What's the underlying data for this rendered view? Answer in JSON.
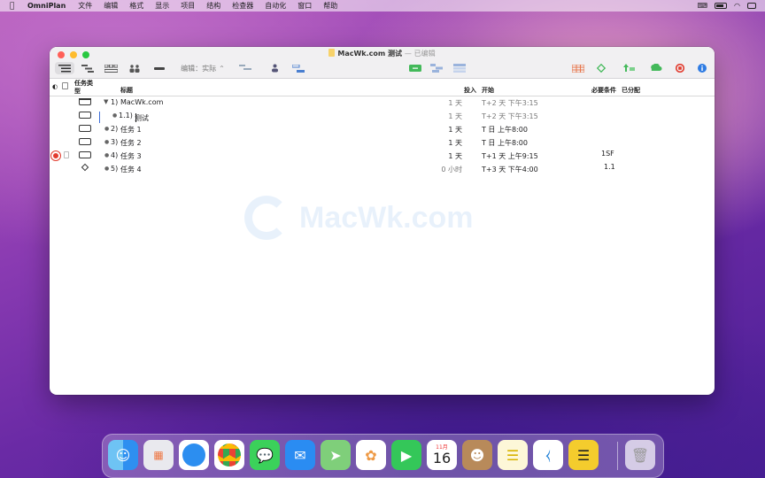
{
  "menubar": {
    "app_name": "OmniPlan",
    "items": [
      "文件",
      "编辑",
      "格式",
      "显示",
      "项目",
      "结构",
      "检查器",
      "自动化",
      "窗口",
      "帮助"
    ]
  },
  "window": {
    "title": "MacWk.com 测试",
    "separator": "—",
    "status": "已编辑"
  },
  "toolbar": {
    "edit_mode_label": "编辑：实际"
  },
  "table": {
    "headers": {
      "task_type": "任务类型",
      "title": "标题",
      "effort": "投入",
      "start": "开始",
      "prereq": "必要条件",
      "assigned": "已分配"
    },
    "rows": [
      {
        "number": "1)",
        "title": "MacWk.com",
        "effort": "1 天",
        "start": "T+2 天 下午3:15",
        "prereq": "",
        "type": "group"
      },
      {
        "number": "1.1)",
        "title": "测试",
        "effort": "1 天",
        "start": "T+2 天 下午3:15",
        "prereq": "",
        "type": "task"
      },
      {
        "number": "2)",
        "title": "任务 1",
        "effort": "1 天",
        "start": "T 日 上午8:00",
        "prereq": "",
        "type": "task"
      },
      {
        "number": "3)",
        "title": "任务 2",
        "effort": "1 天",
        "start": "T 日 上午8:00",
        "prereq": "",
        "type": "task"
      },
      {
        "number": "4)",
        "title": "任务 3",
        "effort": "1 天",
        "start": "T+1 天 上午9:15",
        "prereq": "1SF",
        "type": "task"
      },
      {
        "number": "5)",
        "title": "任务 4",
        "effort": "0 小时",
        "start": "T+3 天 下午4:00",
        "prereq": "1.1",
        "type": "milestone"
      }
    ]
  },
  "watermark": {
    "text": "MacWk.com"
  },
  "dock": {
    "calendar_month": "11月",
    "calendar_day": "16"
  },
  "colors": {
    "accent": "#3f6ed8",
    "close": "#ff5f57",
    "minimize": "#febc2e",
    "zoom": "#28c840",
    "warning": "#e23b2e"
  }
}
